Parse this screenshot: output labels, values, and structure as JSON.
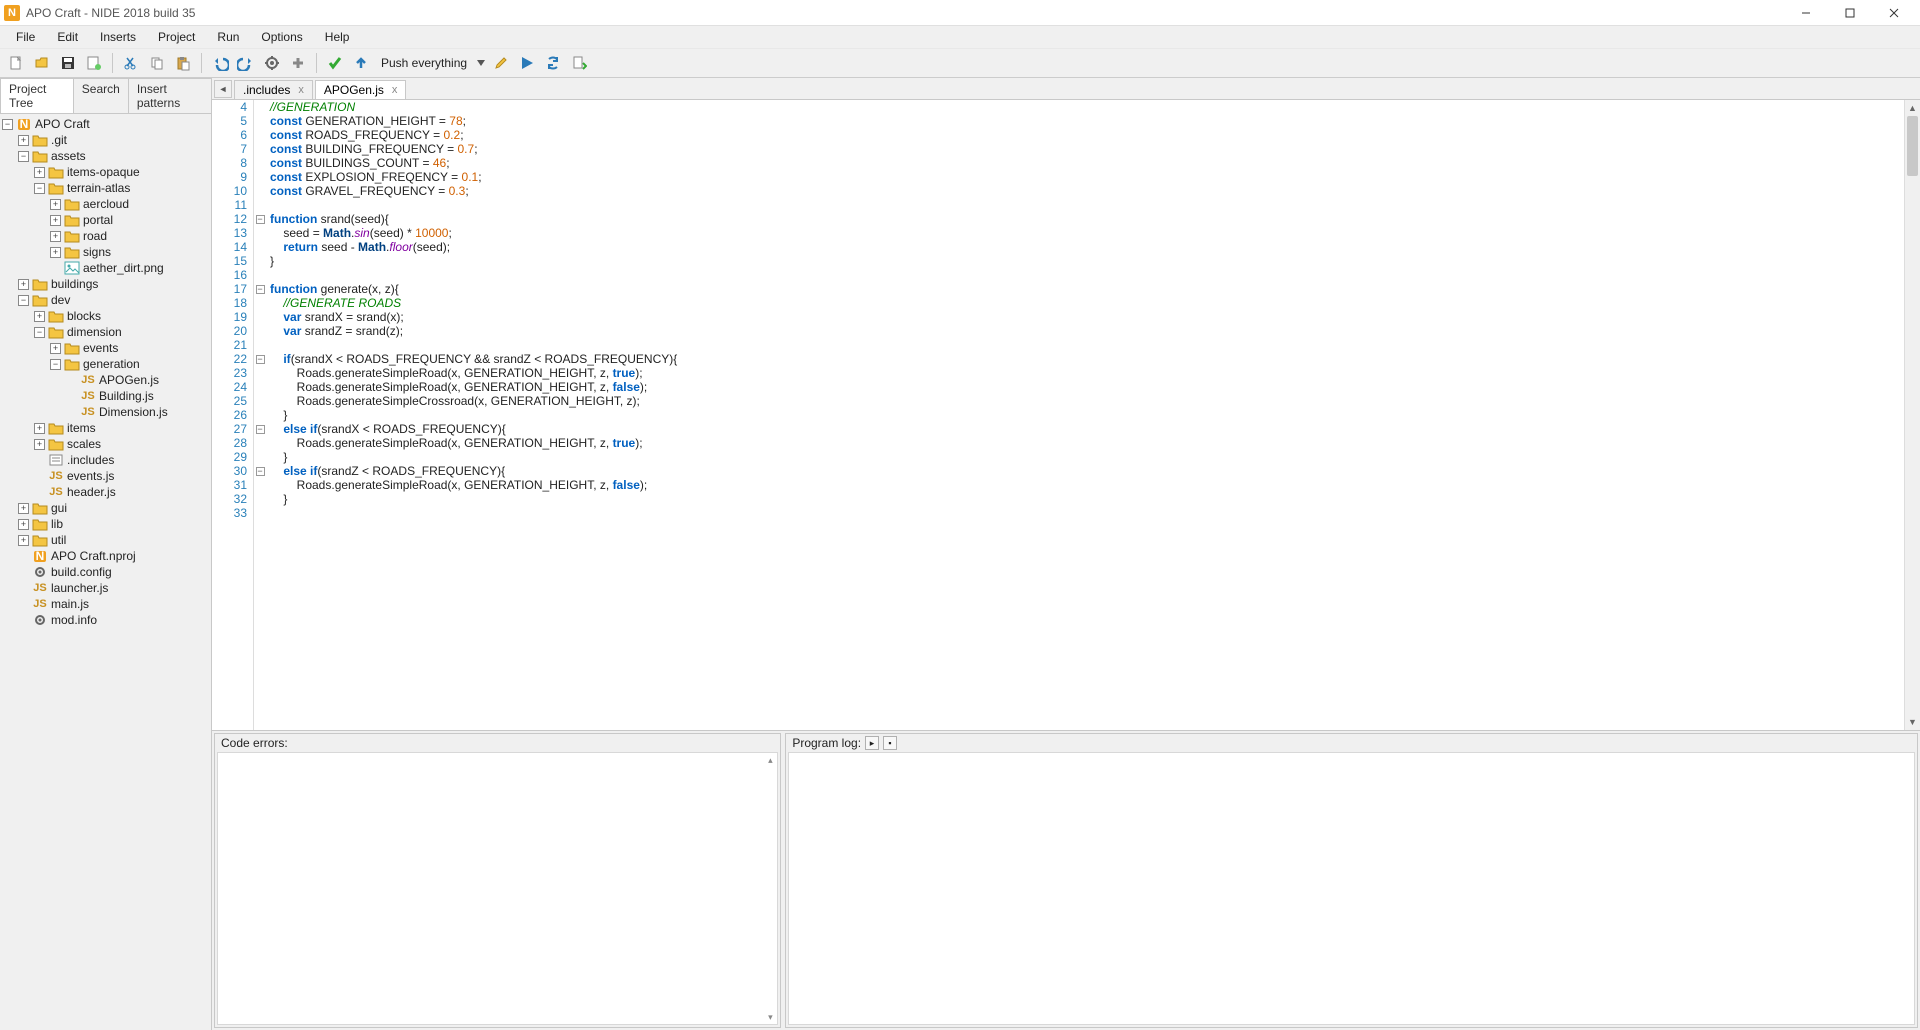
{
  "window": {
    "title": "APO Craft - NIDE 2018 build 35",
    "app_icon_letter": "N"
  },
  "menu": [
    "File",
    "Edit",
    "Inserts",
    "Project",
    "Run",
    "Options",
    "Help"
  ],
  "toolbar": {
    "push_label": "Push everything"
  },
  "sidebar": {
    "tabs": [
      "Project Tree",
      "Search",
      "Insert patterns"
    ]
  },
  "tree": {
    "root": "APO Craft",
    "items": [
      {
        "depth": 0,
        "exp": "-",
        "icon": "proj",
        "label": "APO Craft"
      },
      {
        "depth": 1,
        "exp": "+",
        "icon": "folder",
        "label": ".git"
      },
      {
        "depth": 1,
        "exp": "-",
        "icon": "folderopen",
        "label": "assets"
      },
      {
        "depth": 2,
        "exp": "+",
        "icon": "folder",
        "label": "items-opaque"
      },
      {
        "depth": 2,
        "exp": "-",
        "icon": "folderopen",
        "label": "terrain-atlas"
      },
      {
        "depth": 3,
        "exp": "+",
        "icon": "folder",
        "label": "aercloud"
      },
      {
        "depth": 3,
        "exp": "+",
        "icon": "folder",
        "label": "portal"
      },
      {
        "depth": 3,
        "exp": "+",
        "icon": "folder",
        "label": "road"
      },
      {
        "depth": 3,
        "exp": "+",
        "icon": "folder",
        "label": "signs"
      },
      {
        "depth": 3,
        "exp": " ",
        "icon": "img",
        "label": "aether_dirt.png"
      },
      {
        "depth": 1,
        "exp": "+",
        "icon": "folder",
        "label": "buildings"
      },
      {
        "depth": 1,
        "exp": "-",
        "icon": "folderopen",
        "label": "dev"
      },
      {
        "depth": 2,
        "exp": "+",
        "icon": "folder",
        "label": "blocks"
      },
      {
        "depth": 2,
        "exp": "-",
        "icon": "folderopen",
        "label": "dimension"
      },
      {
        "depth": 3,
        "exp": "+",
        "icon": "folder",
        "label": "events"
      },
      {
        "depth": 3,
        "exp": "-",
        "icon": "folderopen",
        "label": "generation"
      },
      {
        "depth": 4,
        "exp": " ",
        "icon": "js",
        "label": "APOGen.js"
      },
      {
        "depth": 4,
        "exp": " ",
        "icon": "js",
        "label": "Building.js"
      },
      {
        "depth": 4,
        "exp": " ",
        "icon": "js",
        "label": "Dimension.js"
      },
      {
        "depth": 2,
        "exp": "+",
        "icon": "folder",
        "label": "items"
      },
      {
        "depth": 2,
        "exp": "+",
        "icon": "folder",
        "label": "scales"
      },
      {
        "depth": 2,
        "exp": " ",
        "icon": "inc",
        "label": ".includes"
      },
      {
        "depth": 2,
        "exp": " ",
        "icon": "js",
        "label": "events.js"
      },
      {
        "depth": 2,
        "exp": " ",
        "icon": "js",
        "label": "header.js"
      },
      {
        "depth": 1,
        "exp": "+",
        "icon": "folder",
        "label": "gui"
      },
      {
        "depth": 1,
        "exp": "+",
        "icon": "folder",
        "label": "lib"
      },
      {
        "depth": 1,
        "exp": "+",
        "icon": "folder",
        "label": "util"
      },
      {
        "depth": 1,
        "exp": " ",
        "icon": "proj",
        "label": "APO Craft.nproj"
      },
      {
        "depth": 1,
        "exp": " ",
        "icon": "cfg",
        "label": "build.config"
      },
      {
        "depth": 1,
        "exp": " ",
        "icon": "js",
        "label": "launcher.js"
      },
      {
        "depth": 1,
        "exp": " ",
        "icon": "js",
        "label": "main.js"
      },
      {
        "depth": 1,
        "exp": " ",
        "icon": "cfg",
        "label": "mod.info"
      }
    ]
  },
  "editor": {
    "tabs": [
      {
        "label": ".includes",
        "active": false
      },
      {
        "label": "APOGen.js",
        "active": true
      }
    ],
    "first_line_no": 4,
    "lines": [
      {
        "n": 4,
        "fold": "",
        "html": "<span class='c-comment'>//GENERATION</span>"
      },
      {
        "n": 5,
        "fold": "",
        "html": "<span class='c-kw'>const</span> GENERATION_HEIGHT = <span class='c-num'>78</span>;"
      },
      {
        "n": 6,
        "fold": "",
        "html": "<span class='c-kw'>const</span> ROADS_FREQUENCY = <span class='c-num'>0.2</span>;"
      },
      {
        "n": 7,
        "fold": "",
        "html": "<span class='c-kw'>const</span> BUILDING_FREQUENCY = <span class='c-num'>0.7</span>;"
      },
      {
        "n": 8,
        "fold": "",
        "html": "<span class='c-kw'>const</span> BUILDINGS_COUNT = <span class='c-num'>46</span>;"
      },
      {
        "n": 9,
        "fold": "",
        "html": "<span class='c-kw'>const</span> EXPLOSION_FREQENCY = <span class='c-num'>0.1</span>;"
      },
      {
        "n": 10,
        "fold": "",
        "html": "<span class='c-kw'>const</span> GRAVEL_FREQUENCY = <span class='c-num'>0.3</span>;"
      },
      {
        "n": 11,
        "fold": "",
        "html": ""
      },
      {
        "n": 12,
        "fold": "-",
        "html": "<span class='c-kw'>function</span> srand(seed){"
      },
      {
        "n": 13,
        "fold": "",
        "html": "    seed = <span class='c-type'>Math</span>.<span class='c-fn'>sin</span>(seed) * <span class='c-num'>10000</span>;"
      },
      {
        "n": 14,
        "fold": "",
        "html": "    <span class='c-kw'>return</span> seed - <span class='c-type'>Math</span>.<span class='c-fn'>floor</span>(seed);"
      },
      {
        "n": 15,
        "fold": "",
        "html": "}"
      },
      {
        "n": 16,
        "fold": "",
        "html": ""
      },
      {
        "n": 17,
        "fold": "-",
        "html": "<span class='c-kw'>function</span> generate(x, z){"
      },
      {
        "n": 18,
        "fold": "",
        "html": "    <span class='c-comment'>//GENERATE ROADS</span>"
      },
      {
        "n": 19,
        "fold": "",
        "html": "    <span class='c-kw'>var</span> srandX = srand(x);"
      },
      {
        "n": 20,
        "fold": "",
        "html": "    <span class='c-kw'>var</span> srandZ = srand(z);"
      },
      {
        "n": 21,
        "fold": "",
        "html": ""
      },
      {
        "n": 22,
        "fold": "-",
        "html": "    <span class='c-kw'>if</span>(srandX &lt; ROADS_FREQUENCY &amp;&amp; srandZ &lt; ROADS_FREQUENCY){"
      },
      {
        "n": 23,
        "fold": "",
        "html": "        Roads.generateSimpleRoad(x, GENERATION_HEIGHT, z, <span class='c-kw'>true</span>);"
      },
      {
        "n": 24,
        "fold": "",
        "html": "        Roads.generateSimpleRoad(x, GENERATION_HEIGHT, z, <span class='c-kw'>false</span>);"
      },
      {
        "n": 25,
        "fold": "",
        "html": "        Roads.generateSimpleCrossroad(x, GENERATION_HEIGHT, z);"
      },
      {
        "n": 26,
        "fold": "",
        "html": "    }"
      },
      {
        "n": 27,
        "fold": "-",
        "html": "    <span class='c-kw'>else if</span>(srandX &lt; ROADS_FREQUENCY){"
      },
      {
        "n": 28,
        "fold": "",
        "html": "        Roads.generateSimpleRoad(x, GENERATION_HEIGHT, z, <span class='c-kw'>true</span>);"
      },
      {
        "n": 29,
        "fold": "",
        "html": "    }"
      },
      {
        "n": 30,
        "fold": "-",
        "html": "    <span class='c-kw'>else if</span>(srandZ &lt; ROADS_FREQUENCY){"
      },
      {
        "n": 31,
        "fold": "",
        "html": "        Roads.generateSimpleRoad(x, GENERATION_HEIGHT, z, <span class='c-kw'>false</span>);"
      },
      {
        "n": 32,
        "fold": "",
        "html": "    }"
      },
      {
        "n": 33,
        "fold": "",
        "html": ""
      }
    ]
  },
  "panels": {
    "errors_title": "Code errors:",
    "log_title": "Program log:"
  }
}
